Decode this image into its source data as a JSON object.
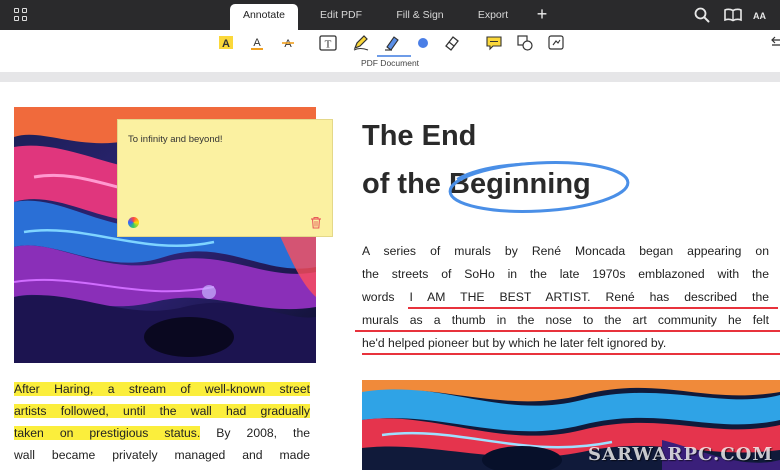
{
  "tabs": [
    {
      "label": "Annotate",
      "active": true
    },
    {
      "label": "Edit PDF",
      "active": false
    },
    {
      "label": "Fill & Sign",
      "active": false
    },
    {
      "label": "Export",
      "active": false
    }
  ],
  "toolbar": {
    "tools": [
      "highlight-text",
      "underline-text",
      "strikethrough-text",
      "text-box",
      "pencil",
      "eraser-pen",
      "color-dot",
      "eraser",
      "comment",
      "shapes",
      "stamp"
    ],
    "selected": "eraser-pen",
    "doc_label": "PDF Document",
    "accent_color": "#6e9ce8"
  },
  "top_right": {
    "text_size_label": "AA"
  },
  "note": {
    "text": "To infinity and beyond!",
    "background": "#fbf1a1"
  },
  "left_text": {
    "highlighted": [
      "After Haring, a stream of well-known street",
      "artists followed, until the wall had gradually",
      "taken on prestigious status."
    ],
    "rest_line3": " By 2008, the",
    "line4": "wall became privately managed and made"
  },
  "title": {
    "line1": "The End",
    "line2_prefix": "of the ",
    "line2_circled": "Beginning",
    "circle_color": "#4a8fe7"
  },
  "body_lines": [
    "A series of murals by René Moncada began appearing on",
    "the streets of SoHo in the late 1970s emblazoned with the",
    "words I AM THE BEST ARTIST. René has described the",
    "murals as a thumb in the nose to the art community he felt",
    "he'd helped pioneer but by which he later felt ignored by."
  ],
  "underline_color": "#e8323c",
  "watermark": "SARWARPC.COM",
  "colors": {
    "topbar": "#2a2a2c",
    "highlight": "#fbee3c",
    "separator": "#e6e6e8"
  }
}
